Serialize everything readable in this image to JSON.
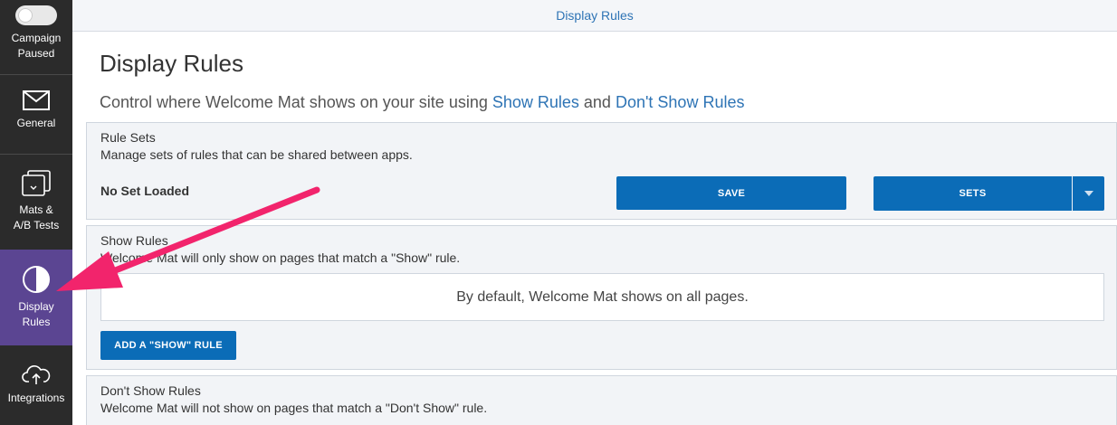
{
  "sidebar": {
    "campaign": {
      "label": "Campaign\nPaused"
    },
    "items": [
      {
        "label": "General",
        "icon": "envelope-icon"
      },
      {
        "label": "Mats &\nA/B Tests",
        "icon": "stacked-windows-icon"
      },
      {
        "label": "Display\nRules",
        "icon": "half-circle-icon"
      },
      {
        "label": "Integrations",
        "icon": "cloud-upload-icon"
      }
    ],
    "colors": {
      "background": "#2b2b2b",
      "active": "#5b4592"
    }
  },
  "header": {
    "title": "Display Rules"
  },
  "page": {
    "title": "Display Rules",
    "subtitle_prefix": "Control where Welcome Mat shows on your site using ",
    "show_rules_link": "Show Rules",
    "subtitle_and": " and ",
    "dont_show_rules_link": "Don't Show Rules"
  },
  "rule_sets": {
    "title": "Rule Sets",
    "description": "Manage sets of rules that can be shared between apps.",
    "status": "No Set Loaded",
    "save_label": "SAVE",
    "sets_label": "SETS"
  },
  "show_rules": {
    "title": "Show Rules",
    "description": "Welcome Mat will only show on pages that match a \"Show\" rule.",
    "default_text": "By default, Welcome Mat shows on all pages.",
    "add_label": "ADD A \"SHOW\" RULE"
  },
  "dont_show_rules": {
    "title": "Don't Show Rules",
    "description": "Welcome Mat will not show on pages that match a \"Don't Show\" rule."
  },
  "colors": {
    "accent": "#2e74b5",
    "button": "#0b6cb7",
    "arrow": "#f2246c"
  }
}
